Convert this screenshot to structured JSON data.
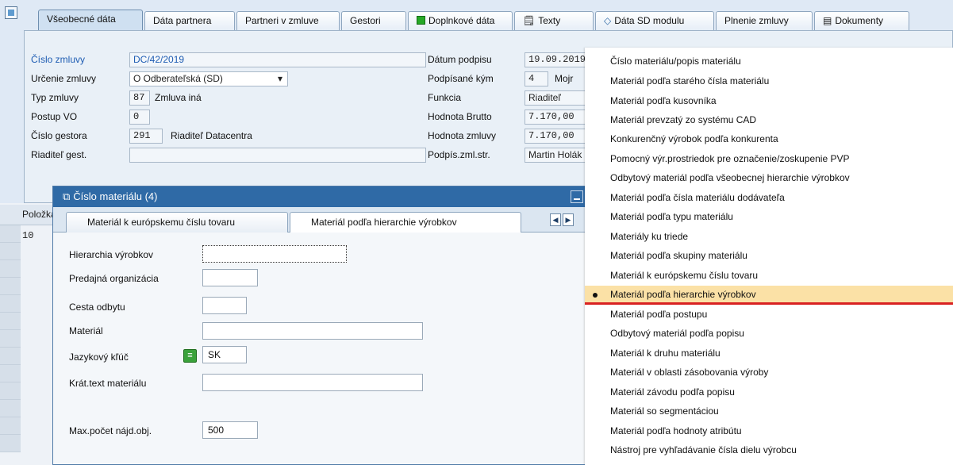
{
  "main_tabs": [
    {
      "label": "Všeobecné dáta",
      "active": true
    },
    {
      "label": "Dáta partnera"
    },
    {
      "label": "Partneri v zmluve"
    },
    {
      "label": "Gestori"
    },
    {
      "label": "Doplnkové dáta",
      "icon": "green-square-icon"
    },
    {
      "label": "Texty",
      "icon": "text-doc-icon"
    },
    {
      "label": "Dáta SD modulu",
      "icon": "diamond-icon"
    },
    {
      "label": "Plnenie zmluvy"
    },
    {
      "label": "Dokumenty",
      "icon": "documents-icon"
    }
  ],
  "form": {
    "cislo_zmluvy": {
      "label": "Číslo zmluvy",
      "value": "DC/42/2019"
    },
    "urcenie_zmluvy": {
      "label": "Určenie zmluvy",
      "value": "O Odberateľská (SD)"
    },
    "typ_zmluvy": {
      "label": "Typ zmluvy",
      "code": "87",
      "text": "Zmluva iná"
    },
    "postup_vo": {
      "label": "Postup VO",
      "value": "0"
    },
    "cislo_gestora": {
      "label": "Číslo gestora",
      "code": "291",
      "text": "Riaditeľ Datacentra"
    },
    "riaditel_gest": {
      "label": "Riaditeľ gest.",
      "value": ""
    },
    "datum_podpisu": {
      "label": "Dátum podpisu",
      "value": "19.09.2019"
    },
    "podpisane_kym": {
      "label": "Podpísané kým",
      "code": "4",
      "text": "Mojr"
    },
    "funkcia": {
      "label": "Funkcia",
      "value": "Riaditeľ"
    },
    "hodnota_brutto": {
      "label": "Hodnota Brutto",
      "value": "7.170,00"
    },
    "hodnota_zmluvy": {
      "label": "Hodnota zmluvy",
      "value": "7.170,00"
    },
    "podpis_zml_str": {
      "label": "Podpís.zml.str.",
      "value": "Martin Holák"
    }
  },
  "table": {
    "header": "Položka",
    "rows": [
      "10"
    ]
  },
  "dialog": {
    "title": "Číslo materiálu (4)",
    "tabs": [
      "Materiál k európskemu číslu tovaru",
      "Materiál podľa hierarchie výrobkov"
    ],
    "fields": [
      {
        "label": "Hierarchia výrobkov",
        "value": ""
      },
      {
        "label": "Predajná organizácia",
        "value": ""
      },
      {
        "label": "Cesta odbytu",
        "value": ""
      },
      {
        "label": "Materiál",
        "value": ""
      },
      {
        "label": "Jazykový kľúč",
        "value": "SK"
      },
      {
        "label": "Krát.text materiálu",
        "value": ""
      },
      {
        "label": "Max.počet nájd.obj.",
        "value": "500"
      }
    ]
  },
  "dropdown": {
    "items": [
      "Číslo materiálu/popis materiálu",
      "Materiál podľa starého čísla materiálu",
      "Materiál podľa kusovníka",
      "Materiál prevzatý zo systému CAD",
      "Konkurenčný výrobok podľa konkurenta",
      "Pomocný výr.prostriedok pre označenie/zoskupenie PVP",
      "Odbytový materiál podľa všeobecnej hierarchie výrobkov",
      "Materiál podľa čísla materiálu dodávateľa",
      "Materiál podľa typu materiálu",
      "Materiály ku triede",
      "Materiál podľa skupiny materiálu",
      "Materiál k európskemu číslu tovaru",
      "Materiál podľa hierarchie výrobkov",
      "Materiál podľa postupu",
      "Odbytový materiál podľa popisu",
      "Materiál k druhu materiálu",
      "Materiál v oblasti zásobovania výroby",
      "Materiál závodu podľa popisu",
      "Materiál so segmentáciou",
      "Materiál podľa hodnoty atribútu",
      "Nástroj pre vyhľadávanie čísla dielu výrobcu"
    ],
    "selected_index": 12
  },
  "colors": {
    "accent": "#2f6aa6",
    "selection": "#fbe1a6",
    "underline": "#d92222",
    "link": "#1f5db3"
  }
}
